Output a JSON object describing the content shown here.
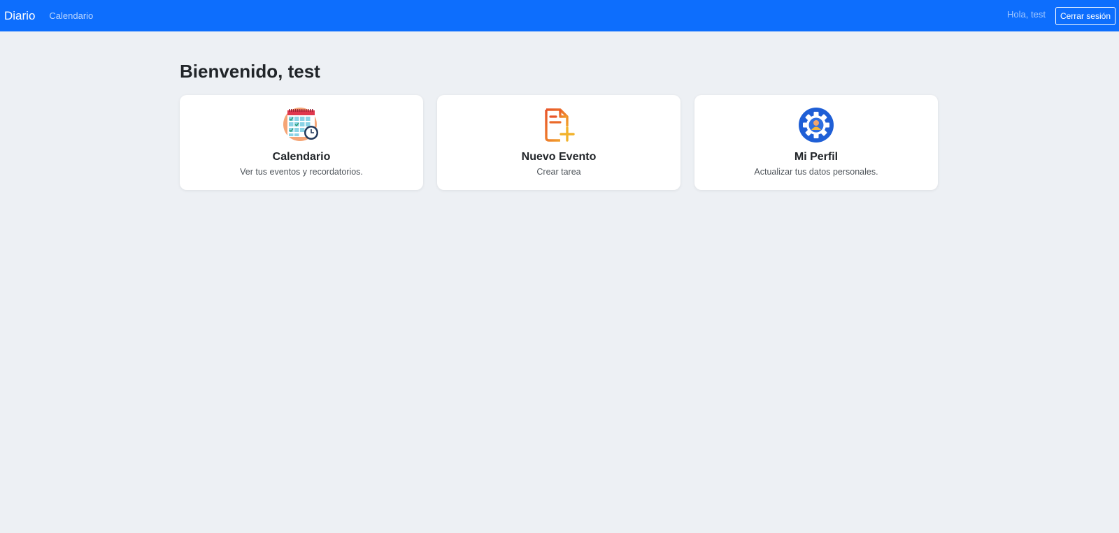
{
  "navbar": {
    "brand": "Diario",
    "link": "Calendario",
    "greeting": "Hola, test",
    "logout_label": "Cerrar sesión",
    "bg_color": "#0d6efd"
  },
  "main": {
    "title": "Bienvenido, test",
    "cards": [
      {
        "title": "Calendario",
        "text": "Ver tus eventos y recordatorios.",
        "icon": "calendar-icon"
      },
      {
        "title": "Nuevo Evento",
        "text": "Crear tarea",
        "icon": "new-document-icon"
      },
      {
        "title": "Mi Perfil",
        "text": "Actualizar tus datos personales.",
        "icon": "profile-settings-icon"
      }
    ]
  }
}
